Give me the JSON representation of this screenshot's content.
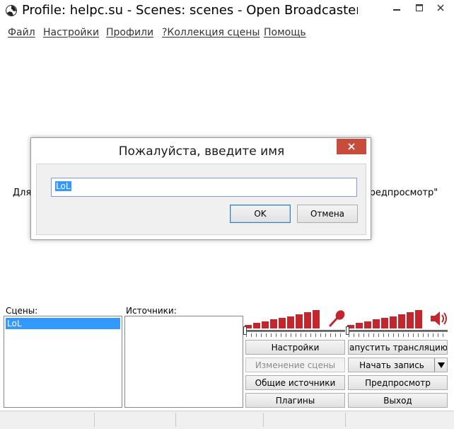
{
  "window": {
    "title": "Profile: helpc.su - Scenes: scenes - Open Broadcaster S...",
    "icon": "obs-logo-icon"
  },
  "menu": {
    "items": [
      {
        "label": "Файл"
      },
      {
        "label": "Настройки"
      },
      {
        "label": "Профили"
      },
      {
        "label": "?Коллекция сцены"
      },
      {
        "label": "Помощь"
      }
    ]
  },
  "preview": {
    "left_text": "Для",
    "right_text": "'редпросмотр\""
  },
  "dialog": {
    "title": "Пожалуйста, введите имя",
    "input_value": "LoL",
    "ok_label": "OK",
    "cancel_label": "Отмена"
  },
  "scenes": {
    "label": "Сцены:",
    "items": [
      "LoL"
    ]
  },
  "sources": {
    "label": "Источники:",
    "items": []
  },
  "meters": {
    "mic_icon": "microphone-icon",
    "speaker_icon": "speaker-icon",
    "bar_color": "#c1272d"
  },
  "buttons": {
    "settings": "Настройки",
    "edit_scene": "Изменение сцены",
    "global_sources": "Общие источники",
    "plugins": "Плагины",
    "start_stream": "апустить трансляцию",
    "start_record": "Начать запись",
    "preview": "Предпросмотр",
    "exit": "Выход"
  }
}
